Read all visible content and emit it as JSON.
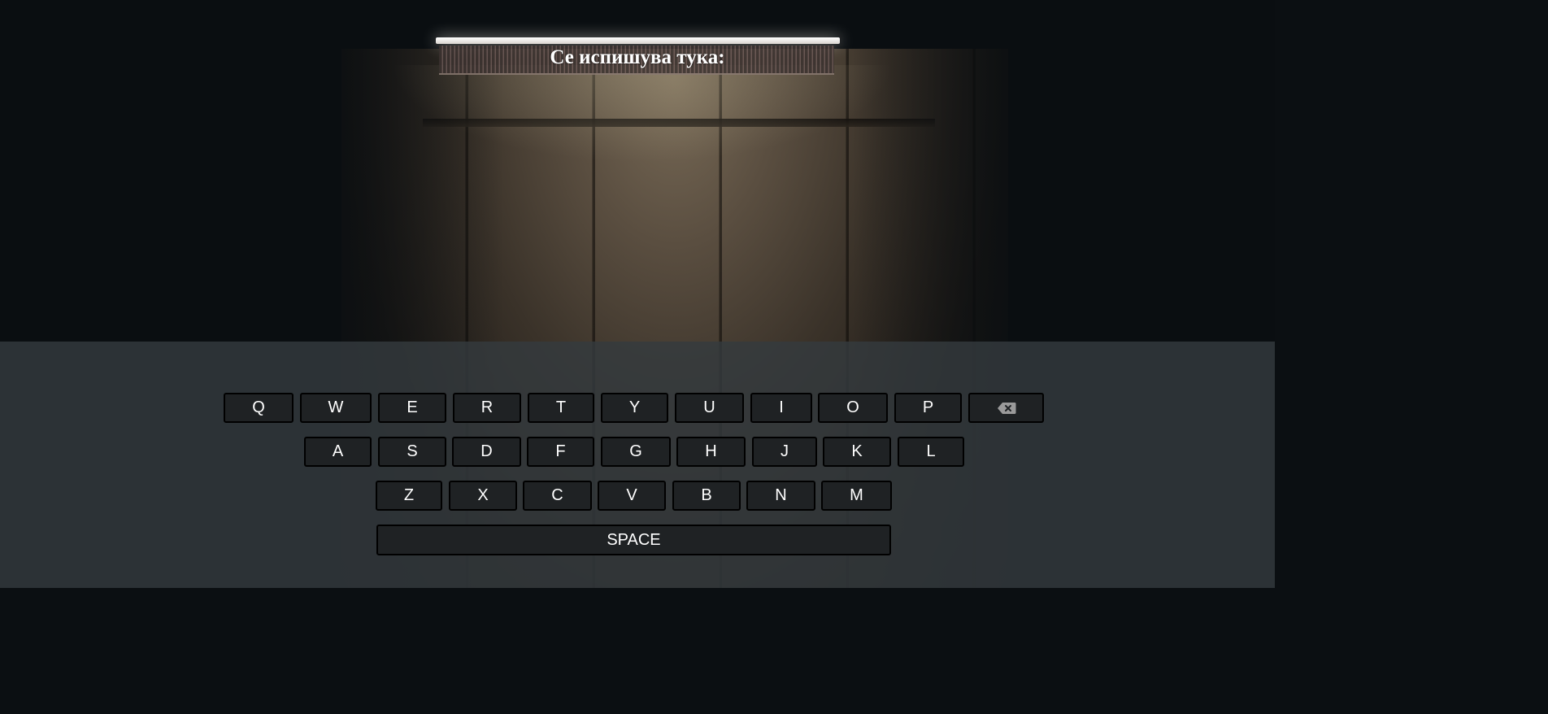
{
  "heading": "Се испишува тука:",
  "keyboard": {
    "row1": [
      "Q",
      "W",
      "E",
      "R",
      "T",
      "Y",
      "U",
      "I",
      "O",
      "P"
    ],
    "row2": [
      "A",
      "S",
      "D",
      "F",
      "G",
      "H",
      "J",
      "K",
      "L"
    ],
    "row3": [
      "Z",
      "X",
      "C",
      "V",
      "B",
      "N",
      "M"
    ],
    "backspace_icon": "backspace-icon",
    "space_label": "SPACE"
  },
  "colors": {
    "key_background": "#1f2224",
    "key_border": "#000000",
    "key_text": "#ffffff",
    "panel_background": "#343a3e",
    "heading_text": "#ffffff"
  }
}
